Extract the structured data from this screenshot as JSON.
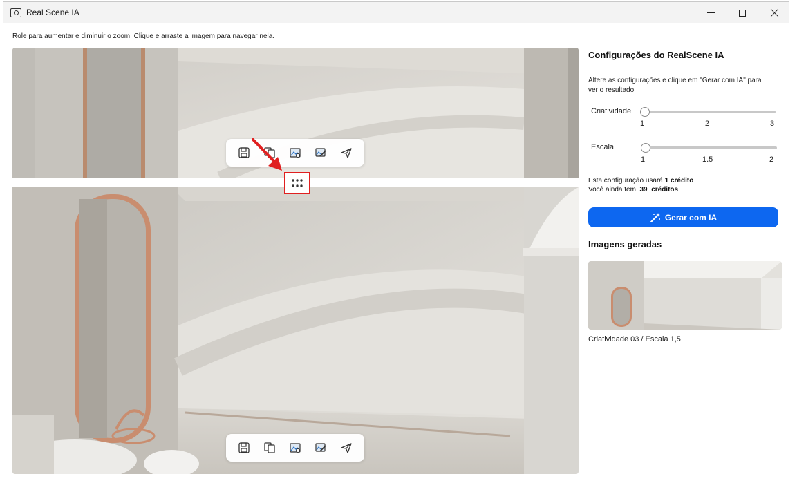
{
  "window": {
    "title": "Real Scene IA",
    "icon": "camera-icon"
  },
  "instructions": "Role para aumentar e diminuir o zoom. Clique e arraste a imagem para navegar nela.",
  "toolbar_icons": [
    "save-icon",
    "copy-icon",
    "image-settings-icon",
    "edit-image-icon",
    "send-icon"
  ],
  "panel": {
    "title": "Configurações do RealScene IA",
    "description": "Altere as configurações e clique em \"Gerar com IA\" para ver o resultado.",
    "creativity": {
      "label": "Criatividade",
      "value": 1,
      "ticks": [
        "1",
        "2",
        "3"
      ]
    },
    "scale": {
      "label": "Escala",
      "value": 1,
      "ticks": [
        "1",
        "1.5",
        "2"
      ]
    },
    "credits": {
      "usage_prefix": "Esta configuração usará",
      "usage_value": "1 crédito",
      "balance_prefix": "Você ainda tem",
      "balance_value": "39",
      "balance_suffix": "créditos"
    },
    "generate_button": "Gerar com IA",
    "gallery_title": "Imagens geradas",
    "gallery_items": [
      {
        "caption": "Criatividade 03 / Escala 1,5"
      }
    ]
  },
  "colors": {
    "accent": "#0d67f0",
    "highlight": "#e02020"
  }
}
